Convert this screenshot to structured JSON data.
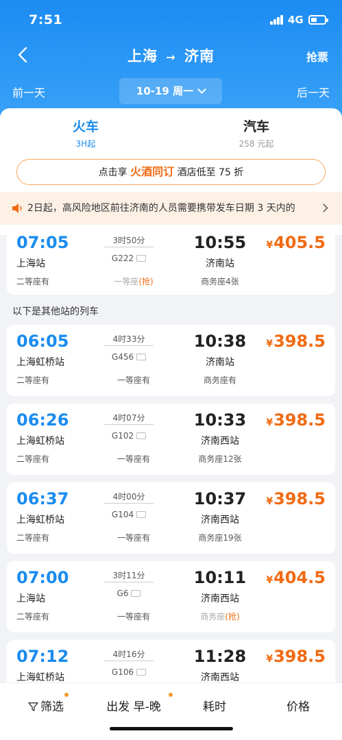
{
  "status": {
    "time": "7:51",
    "network": "4G",
    "battery_level": 0.45
  },
  "nav": {
    "from": "上海",
    "to": "济南",
    "arrow": "→",
    "grab": "抢票"
  },
  "date": {
    "prev": "前一天",
    "current": "10-19 周一",
    "next": "后一天"
  },
  "tabs": {
    "train": {
      "label": "火车",
      "sub": "3H起"
    },
    "bus": {
      "label": "汽车",
      "sub": "258 元起"
    }
  },
  "promo": {
    "pre": "点击享 ",
    "highlight": "火酒同订",
    "post": " 酒店低至 75 折"
  },
  "notice": {
    "text": "2日起，高风险地区前往济南的人员需要携带发车日期 3 天内的"
  },
  "section_label": "以下是其他站的列车",
  "trains": [
    {
      "dep_time": "07:05",
      "dep_station": "上海站",
      "duration": "3时50分",
      "code": "G222",
      "arr_time": "10:55",
      "arr_station": "济南站",
      "yen": "¥",
      "price": "405.5",
      "seat1": "二等座有",
      "seat2": "一等座",
      "seat2_tag": "(抢)",
      "seat3": "商务座4张"
    },
    {
      "dep_time": "06:05",
      "dep_station": "上海虹桥站",
      "duration": "4时33分",
      "code": "G456",
      "arr_time": "10:38",
      "arr_station": "济南站",
      "yen": "¥",
      "price": "398.5",
      "seat1": "二等座有",
      "seat2": "一等座有",
      "seat3": "商务座有"
    },
    {
      "dep_time": "06:26",
      "dep_station": "上海虹桥站",
      "duration": "4时07分",
      "code": "G102",
      "arr_time": "10:33",
      "arr_station": "济南西站",
      "yen": "¥",
      "price": "398.5",
      "seat1": "二等座有",
      "seat2": "一等座有",
      "seat3": "商务座12张"
    },
    {
      "dep_time": "06:37",
      "dep_station": "上海虹桥站",
      "duration": "4时00分",
      "code": "G104",
      "arr_time": "10:37",
      "arr_station": "济南西站",
      "yen": "¥",
      "price": "398.5",
      "seat1": "二等座有",
      "seat2": "一等座有",
      "seat3": "商务座19张"
    },
    {
      "dep_time": "07:00",
      "dep_station": "上海站",
      "duration": "3时11分",
      "code": "G6",
      "arr_time": "10:11",
      "arr_station": "济南西站",
      "yen": "¥",
      "price": "404.5",
      "seat1": "二等座有",
      "seat2": "一等座有",
      "seat3": "商务座",
      "seat3_tag": "(抢)"
    },
    {
      "dep_time": "07:12",
      "dep_station": "上海虹桥站",
      "duration": "4时16分",
      "code": "G106",
      "arr_time": "11:28",
      "arr_station": "济南西站",
      "yen": "¥",
      "price": "398.5",
      "seat1": "",
      "seat2": "",
      "seat3": ""
    }
  ],
  "bottom_bar": {
    "filter": "筛选",
    "departure": "出发 早-晚",
    "duration": "耗时",
    "price": "价格"
  },
  "colors": {
    "header_blue": "#1c8cf3",
    "accent_orange": "#f06b13",
    "time_blue": "#1a8cf0"
  }
}
